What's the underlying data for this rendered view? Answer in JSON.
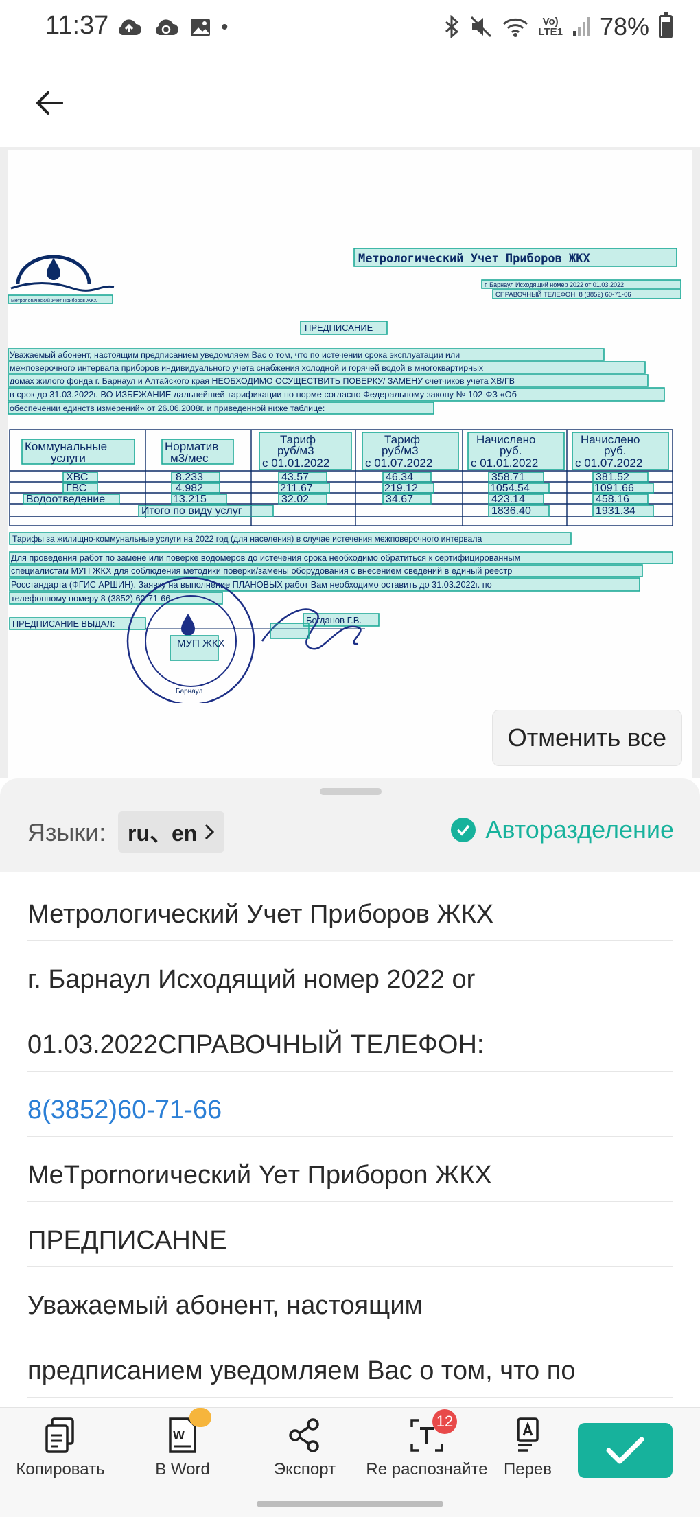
{
  "status_bar": {
    "time": "11:37",
    "lte_top": "Vo)",
    "lte_bottom": "LTE1",
    "battery_percent": "78%"
  },
  "app_bar": {
    "back_icon": "arrow-left-icon"
  },
  "document": {
    "header_title": "Метрологический Учет Приборов ЖКХ",
    "header_line1": "г. Барнаул Исходящий номер 2022 от 01.03.2022",
    "header_line2": "СПРАВОЧНЫЙ ТЕЛЕФОН: 8 (3852) 60-71-66",
    "logo_caption": "Метрологический Учет Приборов ЖКХ",
    "title": "ПРЕДПИСАНИЕ",
    "para1": [
      "Уважаемый абонент, настоящим предписанием уведомляем Вас о том, что по истечении срока эксплуатации или",
      "межповерочного интервала приборов индивидуального учета снабжения холодной и горячей водой в многоквартирных",
      "домах жилого фонда г. Барнаул и Алтайского края НЕОБХОДИМО ОСУЩЕСТВИТЬ ПОВЕРКУ/ ЗАМЕНУ счетчиков учета ХВ/ГВ",
      "в срок до 31.03.2022г. ВО ИЗБЕЖАНИЕ дальнейшей тарификации по норме согласно Федеральному закону № 102-ФЗ «Об",
      "обеспечении единств измерений» от 26.06.2008г. и приведенной ниже таблице:"
    ],
    "table": {
      "headers": [
        [
          "Коммунальные",
          "услуги"
        ],
        [
          "Норматив",
          "м3/мес"
        ],
        [
          "Тариф",
          "руб/м3",
          "с 01.01.2022"
        ],
        [
          "Тариф",
          "руб/м3",
          "с 01.07.2022"
        ],
        [
          "Начислено",
          "руб.",
          "с 01.01.2022"
        ],
        [
          "Начислено",
          "руб.",
          "с 01.07.2022"
        ]
      ],
      "rows": [
        [
          "ХВС",
          "8.233",
          "43.57",
          "46.34",
          "358.71",
          "381.52"
        ],
        [
          "ГВС",
          "4.982",
          "211.67",
          "219.12",
          "1054.54",
          "1091.66"
        ],
        [
          "Водоотведение",
          "13.215",
          "32.02",
          "34.67",
          "423.14",
          "458.16"
        ]
      ],
      "total_label": "Итого по виду услуг",
      "total_values": [
        "1836.40",
        "1931.34"
      ]
    },
    "tariff_note": "Тарифы за жилищно-коммунальные услуги на 2022 год (для населения) в случае истечения межповерочного интервала",
    "para2": [
      "Для проведения работ по замене или поверке водомеров до истечения срока необходимо обратиться к сертифицированным",
      "специалистам МУП ЖКХ для соблюдения методики поверки/замены оборудования с внесением сведений в единый реестр",
      "Росстандарта (ФГИС АРШИН). Заявку на выполнение ПЛАНОВЫХ работ Вам необходимо оставить до 31.03.2022г. по",
      "телефонному номеру 8 (3852) 60-71-66"
    ],
    "issued_by": "ПРЕДПИСАНИЕ ВЫДАЛ:",
    "signer": "Богданов Г.В.",
    "stamp_text": "МУП ЖКХ",
    "stamp_city": "Барнаул"
  },
  "cancel_all_label": "Отменить все",
  "panel": {
    "languages_label": "Языки:",
    "languages_value": "ru、en",
    "auto_split_label": "Авторазделение",
    "lines": [
      "Метрологический Учет Приборов ЖКХ",
      "г. Барнаул Исходящий номер 2022 or",
      "01.03.2022СПРАВОЧНЫЙ ТЕЛЕФОН:",
      "8(3852)60-71-66",
      "MeTpornorический Yeт Приборon ЖКХ",
      "ПРЕДПИСАНNE",
      "Уважаемыӥ абонент, настоящим",
      "предписанием уведомляем Вас о том, что по"
    ]
  },
  "toolbar": {
    "copy_label": "Копировать",
    "word_label": "В Word",
    "export_label": "Экспорт",
    "recognize_label": "Re распознайте",
    "recognize_badge": "12",
    "translate_label": "Перев",
    "word_icon_text": "W"
  }
}
